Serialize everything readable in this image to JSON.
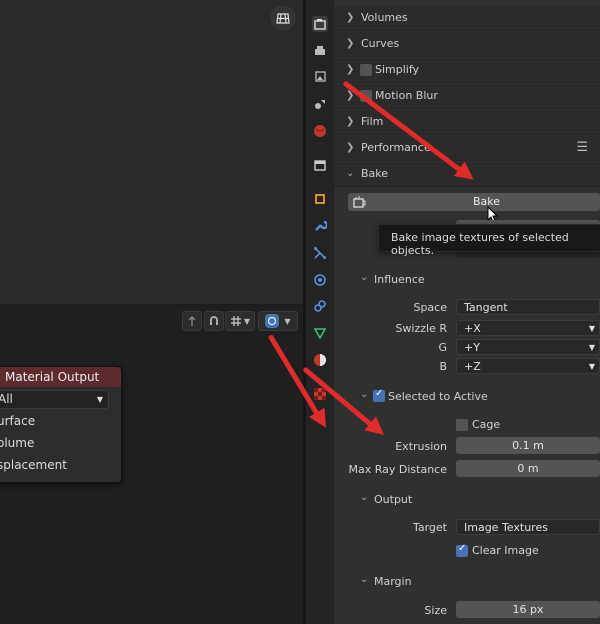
{
  "node_editor": {
    "node_title": "Material Output",
    "target_select": "All",
    "outputs": [
      "urface",
      "olume",
      "splacement"
    ]
  },
  "properties": {
    "collapsed_panels": [
      "Volumes",
      "Curves",
      "Simplify",
      "Motion Blur",
      "Film",
      "Performance"
    ],
    "bake": {
      "header": "Bake",
      "button_label": "Bake",
      "tooltip": "Bake image textures of selected objects.",
      "influence": {
        "header": "Influence",
        "space_label": "Space",
        "space_value": "Tangent",
        "swizzle_r_label": "Swizzle R",
        "swizzle_r_value": "+X",
        "g_label": "G",
        "g_value": "+Y",
        "b_label": "B",
        "b_value": "+Z"
      },
      "selected_to_active": {
        "header": "Selected to Active",
        "cage_label": "Cage",
        "extrusion_label": "Extrusion",
        "extrusion_value": "0.1 m",
        "max_ray_label": "Max Ray Distance",
        "max_ray_value": "0 m"
      },
      "output": {
        "header": "Output",
        "target_label": "Target",
        "target_value": "Image Textures",
        "clear_image_label": "Clear Image"
      },
      "margin": {
        "header": "Margin",
        "size_label": "Size",
        "size_value": "16 px"
      }
    }
  },
  "colors": {
    "accent": "#4772b3",
    "annotation_arrow": "#e02b2b",
    "node_header": "#5d2a2e"
  }
}
